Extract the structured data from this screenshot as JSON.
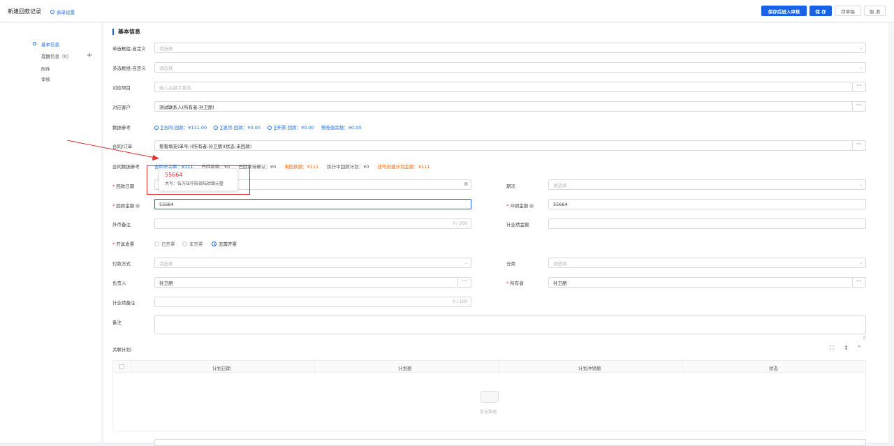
{
  "header": {
    "title": "新建回款记录",
    "form_settings": "表单设置",
    "btn_save_submit": "保存后进入审核",
    "btn_save": "保 存",
    "btn_draft": "存草稿",
    "btn_cancel": "取 消"
  },
  "sidebar": {
    "items": [
      {
        "label": "基本信息"
      },
      {
        "label": "提醒信息（0）"
      },
      {
        "label": "附件"
      },
      {
        "label": "审核"
      }
    ]
  },
  "section": {
    "title": "基本信息"
  },
  "fields": {
    "single_select": {
      "label": "单选框组-自定义",
      "placeholder": "请选择"
    },
    "multi_select": {
      "label": "多选框组-自定义",
      "placeholder": "请选择"
    },
    "project": {
      "label": "对应项目",
      "placeholder": "输入关键字查询"
    },
    "customer": {
      "label": "对应客户",
      "value": "测试联系人(所有者:孙卫朋)"
    },
    "data_ref": {
      "label": "数据参考",
      "items": [
        "∑合同-回款：¥111.00",
        "∑发货-回款：¥0.00",
        "∑开票-回款：¥0.00"
      ],
      "prepay": "预充值余额：¥0.00"
    },
    "contract": {
      "label": "合同/订单",
      "value": "看看填充(单号:)(所有者:孙卫朋)(状态:未回款)"
    },
    "contract_ref": {
      "label": "合同数据参考",
      "total": "合同总金额：¥111",
      "received": "已回款额：¥0",
      "pending": "已回款待确认：¥0",
      "unreceived": "未回款额：¥111",
      "plan": "执行中回款计划：¥0",
      "creatable": "还可创建计划金额：¥111"
    },
    "pay_date": {
      "label": "回款日期"
    },
    "period": {
      "label": "期次",
      "placeholder": "请选择"
    },
    "amount": {
      "label": "回款金额",
      "value": "55664"
    },
    "offset": {
      "label": "冲销金额",
      "value": "55664"
    },
    "fx_note": {
      "label": "外币备注",
      "counter": "0 / 200"
    },
    "perf_amount": {
      "label": "计业绩金额"
    },
    "invoice": {
      "label": "开具发票",
      "opt1": "已开票",
      "opt2": "未开票",
      "opt3": "无需开票"
    },
    "pay_method": {
      "label": "付款方式",
      "placeholder": "请选择"
    },
    "category": {
      "label": "分类",
      "placeholder": "请选择"
    },
    "owner_person": {
      "label": "负责人",
      "value": "孙卫朋"
    },
    "owner": {
      "label": "所有者",
      "value": "孙卫朋"
    },
    "perf_note": {
      "label": "计业绩备注",
      "counter": "0 / 100"
    },
    "remark": {
      "label": "备注",
      "counter": "0"
    }
  },
  "tooltip": {
    "number": "55664",
    "upper": "大写：伍万伍仟陆佰陆拾肆元整"
  },
  "plan_table": {
    "label": "关联计划:",
    "columns": [
      "计划日期",
      "计划额",
      "计划冲销额",
      "状态"
    ],
    "empty": "暂无数据"
  },
  "colors": {
    "primary": "#1762e6",
    "danger": "#f5222d",
    "orange": "#fa6400"
  }
}
